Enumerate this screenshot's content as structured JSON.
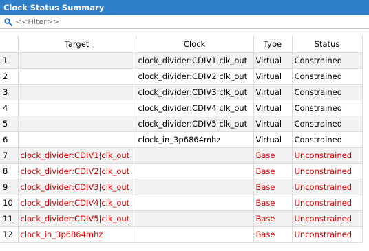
{
  "panel": {
    "title": "Clock Status Summary"
  },
  "filter": {
    "placeholder": "<<Filter>>"
  },
  "table": {
    "headers": {
      "index": "",
      "target": "Target",
      "clock": "Clock",
      "type": "Type",
      "status": "Status"
    },
    "rows": [
      {
        "index": "1",
        "target": "",
        "clock": "clock_divider:CDIV1|clk_out",
        "type": "Virtual",
        "status": "Constrained"
      },
      {
        "index": "2",
        "target": "",
        "clock": "clock_divider:CDIV2|clk_out",
        "type": "Virtual",
        "status": "Constrained"
      },
      {
        "index": "3",
        "target": "",
        "clock": "clock_divider:CDIV3|clk_out",
        "type": "Virtual",
        "status": "Constrained"
      },
      {
        "index": "4",
        "target": "",
        "clock": "clock_divider:CDIV4|clk_out",
        "type": "Virtual",
        "status": "Constrained"
      },
      {
        "index": "5",
        "target": "",
        "clock": "clock_divider:CDIV5|clk_out",
        "type": "Virtual",
        "status": "Constrained"
      },
      {
        "index": "6",
        "target": "",
        "clock": "clock_in_3p6864mhz",
        "type": "Virtual",
        "status": "Constrained"
      },
      {
        "index": "7",
        "target": "clock_divider:CDIV1|clk_out",
        "clock": "",
        "type": "Base",
        "status": "Unconstrained"
      },
      {
        "index": "8",
        "target": "clock_divider:CDIV2|clk_out",
        "clock": "",
        "type": "Base",
        "status": "Unconstrained"
      },
      {
        "index": "9",
        "target": "clock_divider:CDIV3|clk_out",
        "clock": "",
        "type": "Base",
        "status": "Unconstrained"
      },
      {
        "index": "10",
        "target": "clock_divider:CDIV4|clk_out",
        "clock": "",
        "type": "Base",
        "status": "Unconstrained"
      },
      {
        "index": "11",
        "target": "clock_divider:CDIV5|clk_out",
        "clock": "",
        "type": "Base",
        "status": "Unconstrained"
      },
      {
        "index": "12",
        "target": "clock_in_3p6864mhz",
        "clock": "",
        "type": "Base",
        "status": "Unconstrained"
      }
    ]
  },
  "colors": {
    "titlebar": "#2f7fc9",
    "unconstrained": "#d40000",
    "row_alt": "#f2f2f2"
  }
}
